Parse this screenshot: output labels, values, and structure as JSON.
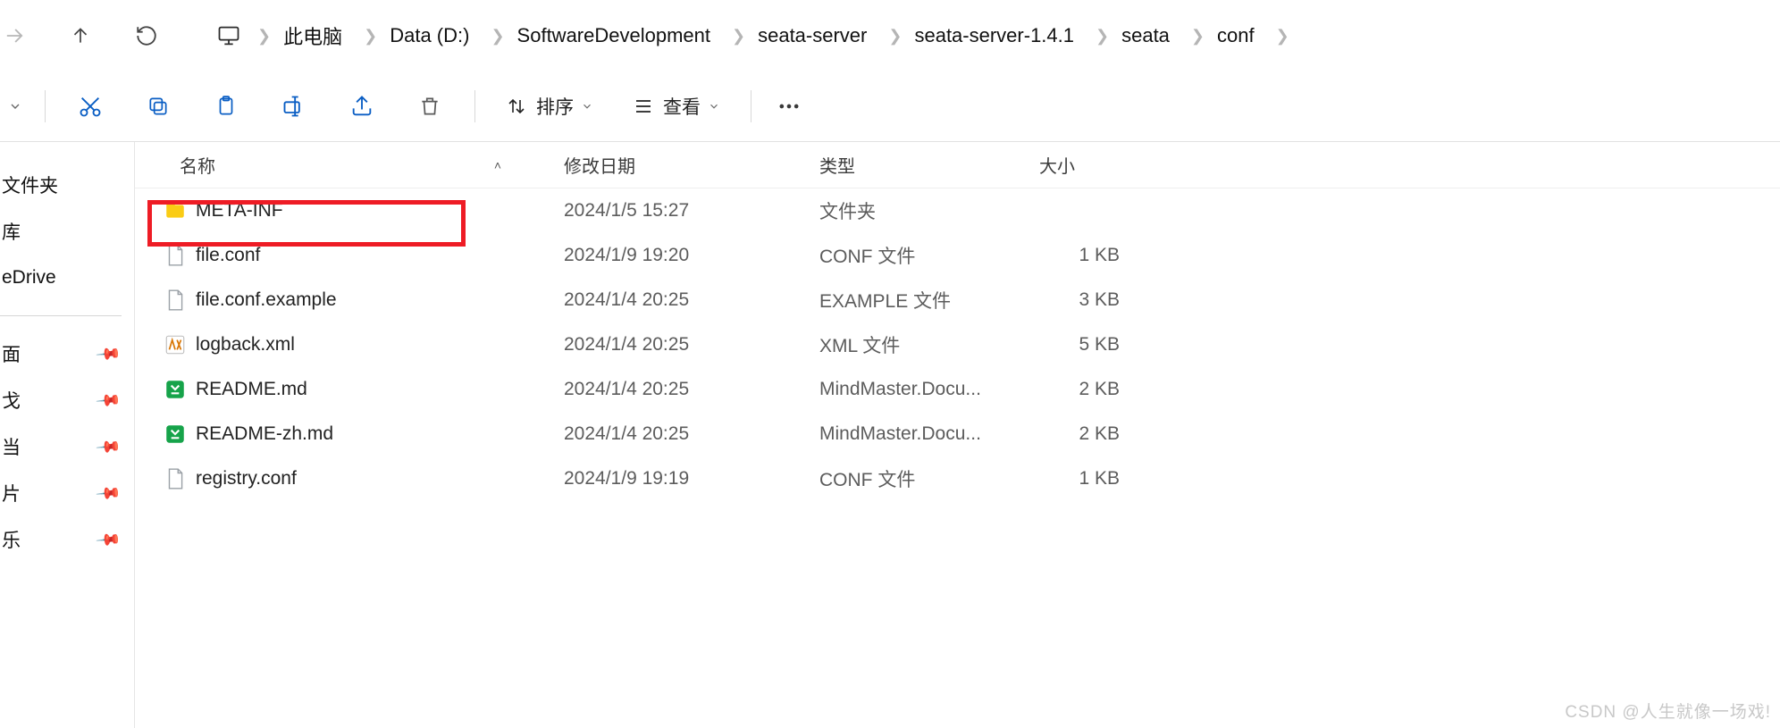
{
  "breadcrumb": {
    "items": [
      "此电脑",
      "Data (D:)",
      "SoftwareDevelopment",
      "seata-server",
      "seata-server-1.4.1",
      "seata",
      "conf"
    ]
  },
  "toolbar": {
    "sort_label": "排序",
    "view_label": "查看"
  },
  "sidebar": {
    "items": [
      {
        "label": "文件夹",
        "pin": false
      },
      {
        "label": "库",
        "pin": false
      },
      {
        "label": "eDrive",
        "pin": false
      },
      {
        "label": "面",
        "pin": true
      },
      {
        "label": "戈",
        "pin": true
      },
      {
        "label": "当",
        "pin": true
      },
      {
        "label": "片",
        "pin": true
      },
      {
        "label": "乐",
        "pin": true
      }
    ]
  },
  "columns": {
    "name": "名称",
    "date": "修改日期",
    "type": "类型",
    "size": "大小"
  },
  "files": [
    {
      "icon": "folder",
      "name": "META-INF",
      "date": "2024/1/5 15:27",
      "type": "文件夹",
      "size": ""
    },
    {
      "icon": "file",
      "name": "file.conf",
      "date": "2024/1/9 19:20",
      "type": "CONF 文件",
      "size": "1 KB",
      "highlight": true
    },
    {
      "icon": "file",
      "name": "file.conf.example",
      "date": "2024/1/4 20:25",
      "type": "EXAMPLE 文件",
      "size": "3 KB"
    },
    {
      "icon": "xml",
      "name": "logback.xml",
      "date": "2024/1/4 20:25",
      "type": "XML 文件",
      "size": "5 KB"
    },
    {
      "icon": "md",
      "name": "README.md",
      "date": "2024/1/4 20:25",
      "type": "MindMaster.Docu...",
      "size": "2 KB"
    },
    {
      "icon": "md",
      "name": "README-zh.md",
      "date": "2024/1/4 20:25",
      "type": "MindMaster.Docu...",
      "size": "2 KB"
    },
    {
      "icon": "file",
      "name": "registry.conf",
      "date": "2024/1/9 19:19",
      "type": "CONF 文件",
      "size": "1 KB"
    }
  ],
  "watermark": "CSDN @人生就像一场戏!"
}
